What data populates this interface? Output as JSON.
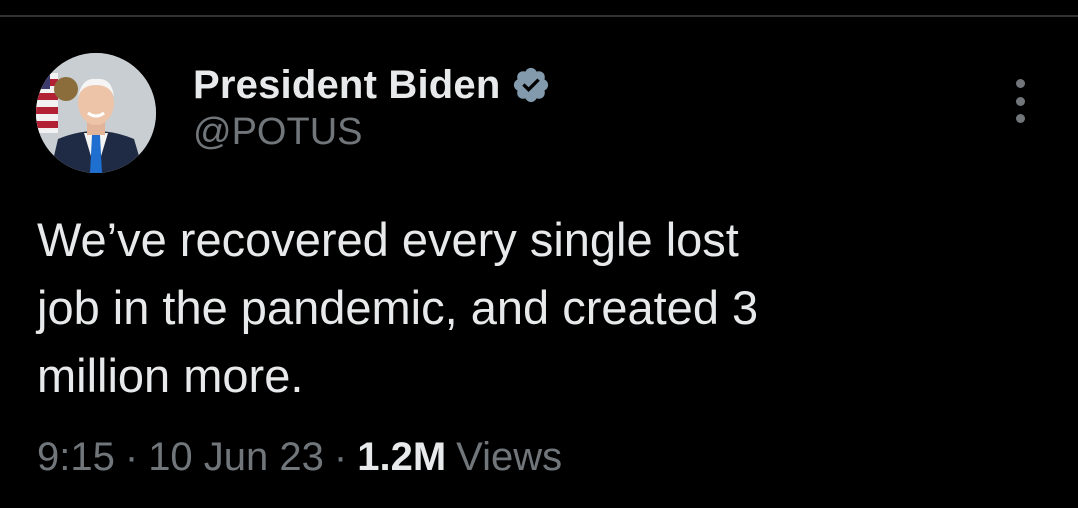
{
  "author": {
    "display_name": "President Biden",
    "handle": "@POTUS",
    "verified": true
  },
  "tweet": {
    "text": "We’ve recovered every single lost\njob in the pandemic, and created 3\nmillion more.",
    "time": "9:15",
    "date": "10 Jun 23",
    "separator": "·",
    "views_count": "1.2M",
    "views_label": "Views"
  },
  "icons": {
    "avatar": "profile-photo",
    "verified": "verified-badge-icon",
    "more": "more-options-icon"
  },
  "colors": {
    "background": "#000000",
    "primary_text": "#e7e9ea",
    "secondary_text": "#71767b",
    "badge": "#829aab",
    "divider": "#2f3336"
  }
}
